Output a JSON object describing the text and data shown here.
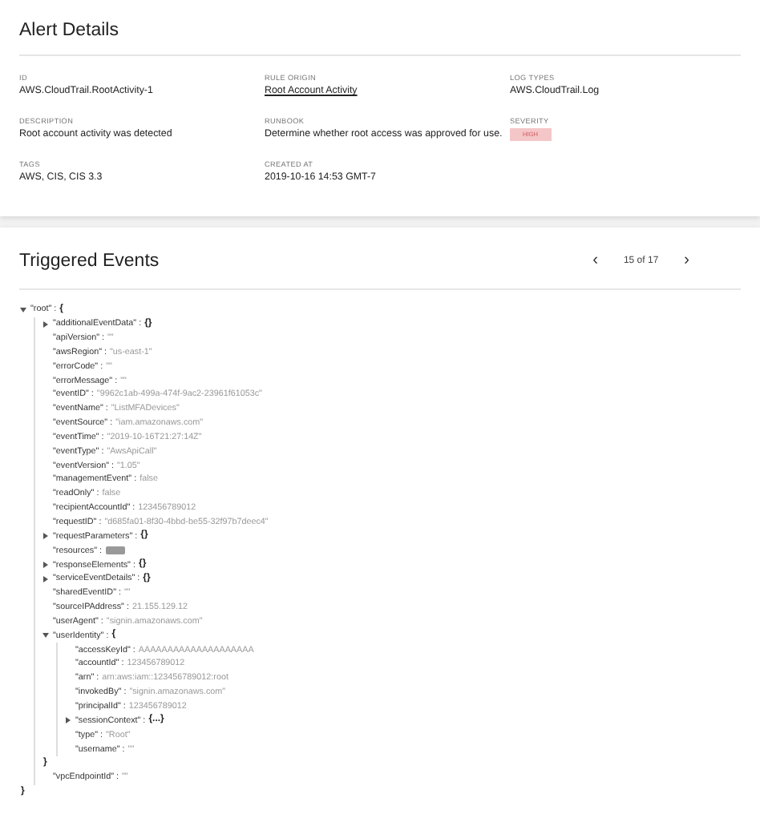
{
  "alert": {
    "title": "Alert Details",
    "fields": [
      {
        "label": "ID",
        "value": "AWS.CloudTrail.RootActivity-1",
        "kind": "text"
      },
      {
        "label": "RULE ORIGIN",
        "value": "Root Account Activity",
        "kind": "link"
      },
      {
        "label": "LOG TYPES",
        "value": "AWS.CloudTrail.Log",
        "kind": "text"
      },
      {
        "label": "DESCRIPTION",
        "value": "Root account activity was detected",
        "kind": "text"
      },
      {
        "label": "RUNBOOK",
        "value": "Determine whether root access was approved for use.",
        "kind": "text"
      },
      {
        "label": "SEVERITY",
        "value": "HIGH",
        "kind": "badge"
      },
      {
        "label": "TAGS",
        "value": "AWS, CIS, CIS 3.3",
        "kind": "text"
      },
      {
        "label": "CREATED AT",
        "value": "2019-10-16 14:53 GMT-7",
        "kind": "text"
      }
    ]
  },
  "events": {
    "title": "Triggered Events",
    "pager": {
      "prev": "‹",
      "label": "15 of 17",
      "next": "›"
    },
    "tree": {
      "key": "\"root\" :",
      "kind": "object",
      "expanded": true,
      "open": "{",
      "close": "}",
      "children": [
        {
          "key": "\"additionalEventData\" :",
          "kind": "object",
          "expanded": false,
          "value": "{}"
        },
        {
          "key": "\"apiVersion\" :",
          "kind": "value",
          "value": "\"\""
        },
        {
          "key": "\"awsRegion\" :",
          "kind": "value",
          "value": "\"us-east-1\""
        },
        {
          "key": "\"errorCode\" :",
          "kind": "value",
          "value": "\"\""
        },
        {
          "key": "\"errorMessage\" :",
          "kind": "value",
          "value": "\"\""
        },
        {
          "key": "\"eventID\" :",
          "kind": "value",
          "value": "\"9962c1ab-499a-474f-9ac2-23961f61053c\""
        },
        {
          "key": "\"eventName\" :",
          "kind": "value",
          "value": "\"ListMFADevices\""
        },
        {
          "key": "\"eventSource\" :",
          "kind": "value",
          "value": "\"iam.amazonaws.com\""
        },
        {
          "key": "\"eventTime\" :",
          "kind": "value",
          "value": "\"2019-10-16T21:27:14Z\""
        },
        {
          "key": "\"eventType\" :",
          "kind": "value",
          "value": "\"AwsApiCall\""
        },
        {
          "key": "\"eventVersion\" :",
          "kind": "value",
          "value": "\"1.05\""
        },
        {
          "key": "\"managementEvent\" :",
          "kind": "value",
          "value": "false"
        },
        {
          "key": "\"readOnly\" :",
          "kind": "value",
          "value": "false"
        },
        {
          "key": "\"recipientAccountId\" :",
          "kind": "value",
          "value": "123456789012"
        },
        {
          "key": "\"requestID\" :",
          "kind": "value",
          "value": "\"d685fa01-8f30-4bbd-be55-32f97b7deec4\""
        },
        {
          "key": "\"requestParameters\" :",
          "kind": "object",
          "expanded": false,
          "value": "{}"
        },
        {
          "key": "\"resources\" :",
          "kind": "chip"
        },
        {
          "key": "\"responseElements\" :",
          "kind": "object",
          "expanded": false,
          "value": "{}"
        },
        {
          "key": "\"serviceEventDetails\" :",
          "kind": "object",
          "expanded": false,
          "value": "{}"
        },
        {
          "key": "\"sharedEventID\" :",
          "kind": "value",
          "value": "\"\""
        },
        {
          "key": "\"sourceIPAddress\" :",
          "kind": "value",
          "value": "21.155.129.12"
        },
        {
          "key": "\"userAgent\" :",
          "kind": "value",
          "value": "\"signin.amazonaws.com\""
        },
        {
          "key": "\"userIdentity\" :",
          "kind": "object",
          "expanded": true,
          "open": "{",
          "close": "}",
          "children": [
            {
              "key": "\"accessKeyId\" :",
              "kind": "value",
              "value": "AAAAAAAAAAAAAAAAAAAA"
            },
            {
              "key": "\"accountId\" :",
              "kind": "value",
              "value": "123456789012"
            },
            {
              "key": "\"arn\" :",
              "kind": "value",
              "value": "arn:aws:iam::123456789012:root"
            },
            {
              "key": "\"invokedBy\" :",
              "kind": "value",
              "value": "\"signin.amazonaws.com\""
            },
            {
              "key": "\"principalId\" :",
              "kind": "value",
              "value": "123456789012"
            },
            {
              "key": "\"sessionContext\" :",
              "kind": "object",
              "expanded": false,
              "value": "{...}"
            },
            {
              "key": "\"type\" :",
              "kind": "value",
              "value": "\"Root\""
            },
            {
              "key": "\"username\" :",
              "kind": "value",
              "value": "\"\""
            }
          ]
        },
        {
          "key": "\"vpcEndpointId\" :",
          "kind": "value",
          "value": "\"\""
        }
      ]
    }
  }
}
